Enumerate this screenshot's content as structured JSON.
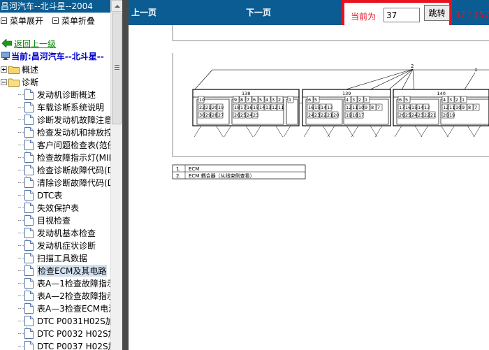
{
  "app": {
    "title": "昌河汽车--北斗星--2004"
  },
  "sidebar": {
    "menu_expand": "菜单展开",
    "menu_collapse": "菜单折叠",
    "back_label": "返回上一级",
    "current_label": "当前:昌河汽车--北斗星--",
    "folders": [
      {
        "label": "概述",
        "expanded": false
      },
      {
        "label": "诊断",
        "expanded": true
      }
    ],
    "items": [
      {
        "label": "发动机诊断概述"
      },
      {
        "label": "车载诊断系统说明"
      },
      {
        "label": "诊断发动机故障注意"
      },
      {
        "label": "检查发动机和排放控"
      },
      {
        "label": "客户问题检查表(范例"
      },
      {
        "label": "检查故障指示灯(MIL"
      },
      {
        "label": "检查诊断故障代码(D"
      },
      {
        "label": "清除诊断故障代码(D"
      },
      {
        "label": " DTC表"
      },
      {
        "label": "失效保护表"
      },
      {
        "label": "目视检查"
      },
      {
        "label": "发动机基本检查"
      },
      {
        "label": "发动机症状诊断"
      },
      {
        "label": "扫描工具数据"
      },
      {
        "label": "检查ECM及其电路",
        "selected": true
      },
      {
        "label": "表A—1检查故障指示"
      },
      {
        "label": "表A—2检查故障指示"
      },
      {
        "label": "表A—3检查ECM电源"
      },
      {
        "label": "DTC P0031H02S加热"
      },
      {
        "label": "DTC P0032 H02S加"
      },
      {
        "label": "DTC P0037 H02S加"
      }
    ]
  },
  "toolbar": {
    "prev_label": "上一页",
    "next_label": "下一页",
    "current_page_label": "当前为",
    "current_page_value": "37",
    "jump_label": "跳转",
    "page_count": "37 / 157"
  },
  "diagram": {
    "callouts": {
      "two": "2",
      "one": "1"
    },
    "connectors": [
      {
        "id": "138",
        "blocks": [
          {
            "row1": [
              "10"
            ],
            "row2": [
              "22",
              "21",
              "20",
              "19"
            ],
            "row3": [
              "30",
              "29",
              "28",
              "27"
            ]
          },
          {
            "row1": [
              "9",
              "8",
              "7",
              "6",
              "5",
              "4",
              "3",
              "2"
            ],
            "row2": [
              "18",
              "17",
              "16",
              "15",
              "14",
              "13",
              "12",
              "11"
            ],
            "row3": [
              "26",
              "25",
              "24",
              "23"
            ]
          },
          {
            "row1": [
              "1"
            ],
            "row2": [],
            "row3": []
          }
        ]
      },
      {
        "id": "139",
        "blocks": [
          {
            "row1": [
              "6",
              "5"
            ],
            "row2": [
              "16",
              "15",
              "14",
              "13"
            ],
            "row3": [
              "24",
              "23",
              "22",
              "21",
              "20"
            ]
          },
          {
            "row1": [
              "4",
              "3",
              "2",
              "1"
            ],
            "row2": [
              "12",
              "11",
              "10",
              "9",
              "8",
              "7"
            ],
            "row3": [
              "19",
              "18",
              "17"
            ]
          }
        ]
      },
      {
        "id": "140",
        "blocks": [
          {
            "row1": [
              "6",
              "5"
            ],
            "row2": [
              "17",
              "16",
              "15",
              "14",
              "13"
            ],
            "row3": [
              "26",
              "25",
              "24",
              "23",
              "22",
              "21"
            ]
          },
          {
            "row1": [
              "4",
              "3",
              "2",
              "1"
            ],
            "row2": [
              "12",
              "11",
              "10",
              "9",
              "8",
              "7"
            ],
            "row3": [
              "20",
              "19"
            ]
          }
        ]
      }
    ],
    "legend": [
      {
        "num": "1.",
        "text": "ECM"
      },
      {
        "num": "2.",
        "text": "ECM 耦合器（从线束侧查看）"
      }
    ]
  },
  "colors": {
    "header_blue": "#0a5c92",
    "highlight_red": "#e8121e",
    "link_green": "#008000",
    "current_blue": "#0000cc",
    "selected_bg": "#d4e1ef"
  }
}
